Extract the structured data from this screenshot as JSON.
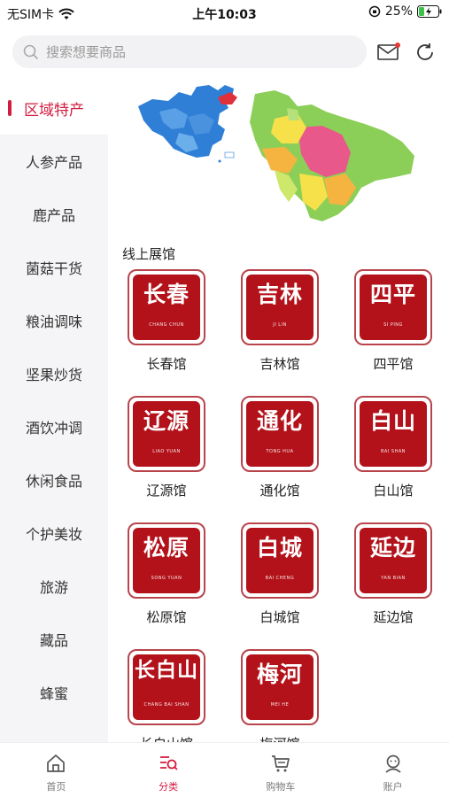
{
  "status_bar": {
    "carrier": "无SIM卡",
    "time": "上午10:03",
    "battery": "25%"
  },
  "search": {
    "placeholder": "搜索想要商品"
  },
  "sidebar": {
    "items": [
      {
        "label": "区域特产",
        "active": true
      },
      {
        "label": "人参产品"
      },
      {
        "label": "鹿产品"
      },
      {
        "label": "菌菇干货"
      },
      {
        "label": "粮油调味"
      },
      {
        "label": "坚果炒货"
      },
      {
        "label": "酒饮冲调"
      },
      {
        "label": "休闲食品"
      },
      {
        "label": "个护美妆"
      },
      {
        "label": "旅游"
      },
      {
        "label": "藏品"
      },
      {
        "label": "蜂蜜"
      }
    ]
  },
  "content": {
    "section_title": "线上展馆",
    "halls": [
      {
        "label": "长春馆",
        "logo": "长春",
        "pinyin": "CHANG CHUN"
      },
      {
        "label": "吉林馆",
        "logo": "吉林",
        "pinyin": "JI LIN"
      },
      {
        "label": "四平馆",
        "logo": "四平",
        "pinyin": "SI PING"
      },
      {
        "label": "辽源馆",
        "logo": "辽源",
        "pinyin": "LIAO YUAN"
      },
      {
        "label": "通化馆",
        "logo": "通化",
        "pinyin": "TONG HUA"
      },
      {
        "label": "白山馆",
        "logo": "白山",
        "pinyin": "BAI SHAN"
      },
      {
        "label": "松原馆",
        "logo": "松原",
        "pinyin": "SONG YUAN"
      },
      {
        "label": "白城馆",
        "logo": "白城",
        "pinyin": "BAI CHENG"
      },
      {
        "label": "延边馆",
        "logo": "延边",
        "pinyin": "YAN BIAN"
      },
      {
        "label": "长白山馆",
        "logo": "长白山",
        "pinyin": "CHANG BAI SHAN"
      },
      {
        "label": "梅河馆",
        "logo": "梅河",
        "pinyin": "MEI HE"
      }
    ]
  },
  "tabbar": [
    {
      "label": "首页",
      "icon": "home-icon"
    },
    {
      "label": "分类",
      "icon": "category-icon",
      "active": true
    },
    {
      "label": "购物车",
      "icon": "cart-icon"
    },
    {
      "label": "账户",
      "icon": "account-icon"
    }
  ],
  "colors": {
    "accent": "#d31d40",
    "tile_red": "#b3121a",
    "sidebar_bg": "#f5f5f7"
  }
}
